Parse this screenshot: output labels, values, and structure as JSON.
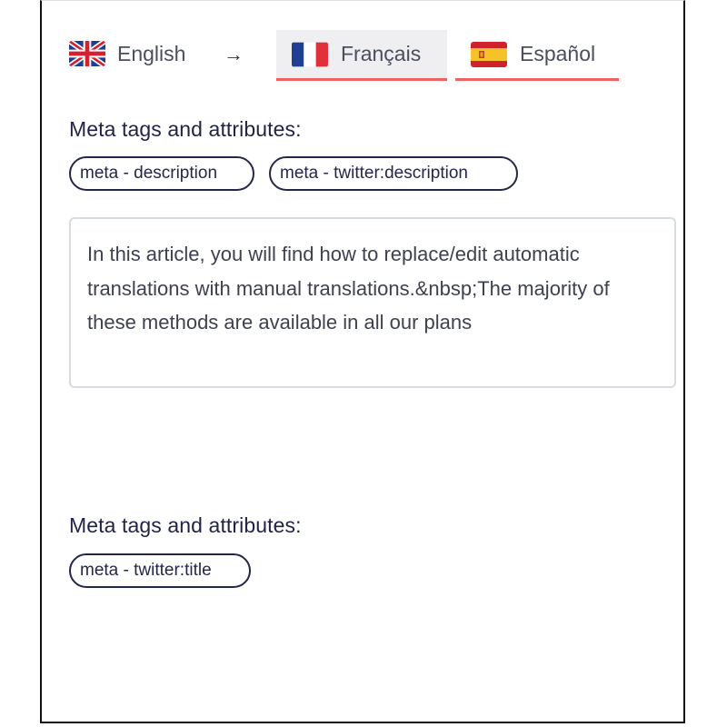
{
  "languages": {
    "source": {
      "label": "English",
      "flag": "uk-flag-icon"
    },
    "targets": [
      {
        "label": "Français",
        "flag": "france-flag-icon",
        "active": true
      },
      {
        "label": "Español",
        "flag": "spain-flag-icon",
        "active": false
      }
    ],
    "arrow": "→"
  },
  "sections": [
    {
      "title": "Meta tags and attributes:",
      "tags": [
        "meta - description",
        "meta - twitter:description"
      ],
      "text": "In this article, you will find how to replace/edit automatic translations with manual translations.&nbsp;The majority of these methods are available in all our plans"
    },
    {
      "title": "Meta tags and attributes:",
      "tags": [
        "meta - twitter:title"
      ]
    }
  ],
  "colors": {
    "accent_underline": "#f06262",
    "heading": "#1f2347",
    "chip_border": "#23284a",
    "active_tab_bg": "#efeff1"
  }
}
